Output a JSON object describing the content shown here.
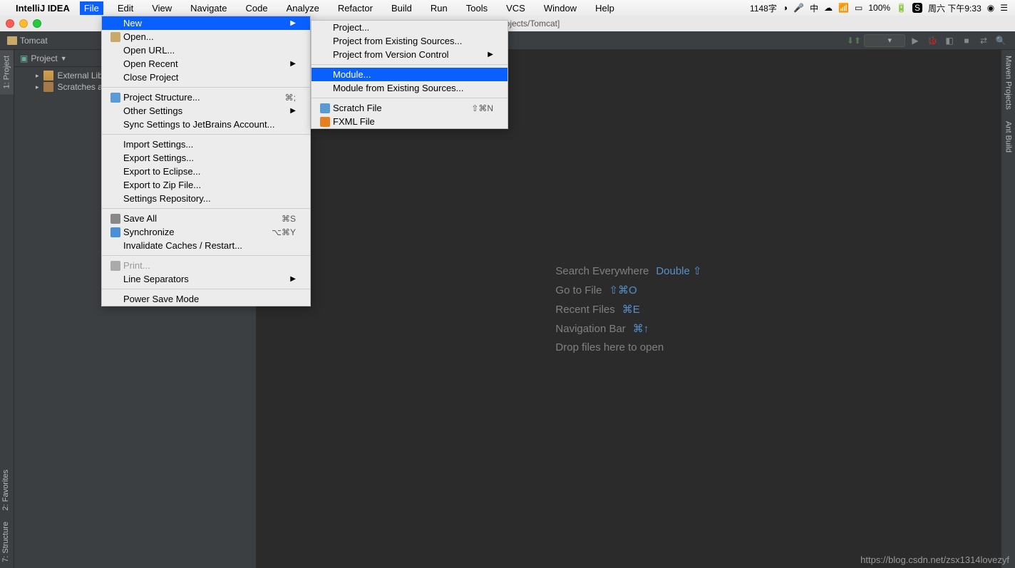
{
  "mac_menubar": {
    "app_name": "IntelliJ IDEA",
    "items": [
      "File",
      "Edit",
      "View",
      "Navigate",
      "Code",
      "Analyze",
      "Refactor",
      "Build",
      "Run",
      "Tools",
      "VCS",
      "Window",
      "Help"
    ],
    "active_index": 0,
    "status": {
      "ime": "1148字",
      "battery": "100%",
      "datetime": "周六 下午9:33"
    }
  },
  "title_bar": {
    "text": "Projects/Tomcat]"
  },
  "breadcrumb": {
    "project": "Tomcat"
  },
  "project_panel": {
    "title": "Project",
    "items": [
      {
        "label": "External Librar",
        "icon": "lib"
      },
      {
        "label": "Scratches and",
        "icon": "scratch"
      }
    ]
  },
  "editor_hints": [
    {
      "label": "Search Everywhere",
      "key": "Double ⇧"
    },
    {
      "label": "Go to File",
      "key": "⇧⌘O"
    },
    {
      "label": "Recent Files",
      "key": "⌘E"
    },
    {
      "label": "Navigation Bar",
      "key": "⌘↑"
    },
    {
      "label": "Drop files here to open",
      "key": ""
    }
  ],
  "file_menu": {
    "groups": [
      [
        {
          "label": "New",
          "highlight": true,
          "submenu": true
        },
        {
          "label": "Open...",
          "icon": "folder"
        },
        {
          "label": "Open URL..."
        },
        {
          "label": "Open Recent",
          "submenu": true
        },
        {
          "label": "Close Project"
        }
      ],
      [
        {
          "label": "Project Structure...",
          "icon": "structure",
          "shortcut": "⌘;"
        },
        {
          "label": "Other Settings",
          "submenu": true
        },
        {
          "label": "Sync Settings to JetBrains Account..."
        }
      ],
      [
        {
          "label": "Import Settings..."
        },
        {
          "label": "Export Settings..."
        },
        {
          "label": "Export to Eclipse..."
        },
        {
          "label": "Export to Zip File..."
        },
        {
          "label": "Settings Repository..."
        }
      ],
      [
        {
          "label": "Save All",
          "icon": "save",
          "shortcut": "⌘S"
        },
        {
          "label": "Synchronize",
          "icon": "sync",
          "shortcut": "⌥⌘Y"
        },
        {
          "label": "Invalidate Caches / Restart..."
        }
      ],
      [
        {
          "label": "Print...",
          "icon": "print",
          "disabled": true
        },
        {
          "label": "Line Separators",
          "submenu": true
        }
      ],
      [
        {
          "label": "Power Save Mode"
        }
      ]
    ]
  },
  "new_submenu": {
    "groups": [
      [
        {
          "label": "Project..."
        },
        {
          "label": "Project from Existing Sources..."
        },
        {
          "label": "Project from Version Control",
          "submenu": true
        }
      ],
      [
        {
          "label": "Module...",
          "highlight": true
        },
        {
          "label": "Module from Existing Sources..."
        }
      ],
      [
        {
          "label": "Scratch File",
          "icon": "scratch-file",
          "shortcut": "⇧⌘N"
        },
        {
          "label": "FXML File",
          "icon": "fxml"
        }
      ]
    ]
  },
  "left_tabs": {
    "project": "1: Project",
    "favorites": "2: Favorites",
    "structure": "7: Structure"
  },
  "right_tabs": {
    "maven": "Maven Projects",
    "ant": "Ant Build"
  },
  "watermark": "https://blog.csdn.net/zsx1314lovezyf"
}
